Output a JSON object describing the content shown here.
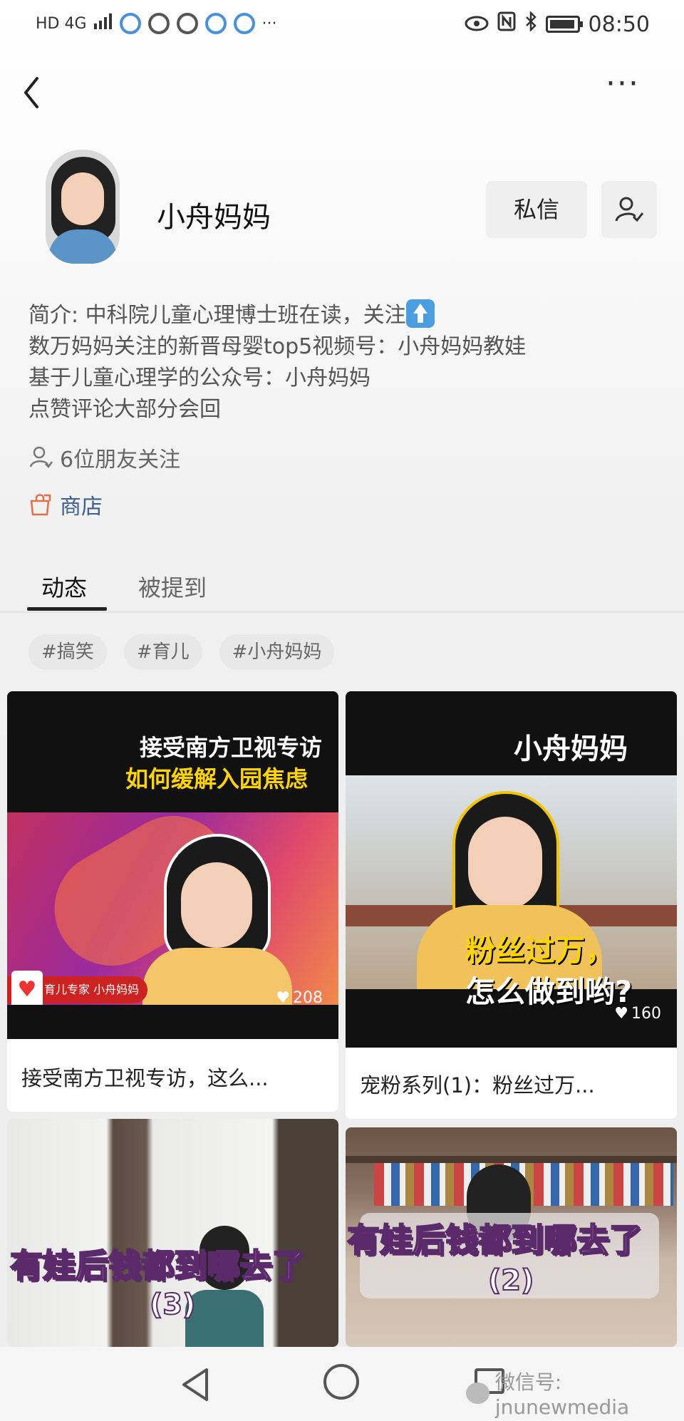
{
  "status_bar": {
    "left": "HD 4G",
    "time": "08:50"
  },
  "topbar": {
    "more": "···"
  },
  "profile": {
    "name": "小舟妈妈",
    "message_button": "私信"
  },
  "bio": {
    "line1": "简介: 中科院儿童心理博士班在读，关注",
    "line2": "数万妈妈关注的新晋母婴top5视频号：小舟妈妈教娃",
    "line3": "基于儿童心理学的公众号：小舟妈妈",
    "line4": "点赞评论大部分会回"
  },
  "friends": {
    "text": "6位朋友关注"
  },
  "shop": {
    "label": "商店"
  },
  "tabs": [
    {
      "label": "动态"
    },
    {
      "label": "被提到"
    }
  ],
  "tags": [
    "#搞笑",
    "#育儿",
    "#小舟妈妈"
  ],
  "cards": [
    {
      "overlay_line1": "接受南方卫视专访",
      "overlay_line2": "如何缓解入园焦虑",
      "badge": "育儿专家 小舟妈妈",
      "likes": "208",
      "title": "接受南方卫视专访，这么..."
    },
    {
      "overlay_top": "小舟妈妈",
      "overlay_line1": "粉丝过万，",
      "overlay_line2": "怎么做到哟?",
      "likes": "160",
      "title": "宠粉系列(1)：粉丝过万..."
    },
    {
      "overlay_line1": "有娃后钱都到哪去了",
      "overlay_line2": "(3)"
    },
    {
      "overlay_line1": "有娃后钱都到哪去了",
      "overlay_line2": "(2)"
    }
  ],
  "watermark": {
    "text": "微信号: jnunewmedia"
  },
  "colors": {
    "accent_link": "#3e5f8f",
    "shop_icon": "#e0704a",
    "overlay_yellow": "#ffd400"
  }
}
